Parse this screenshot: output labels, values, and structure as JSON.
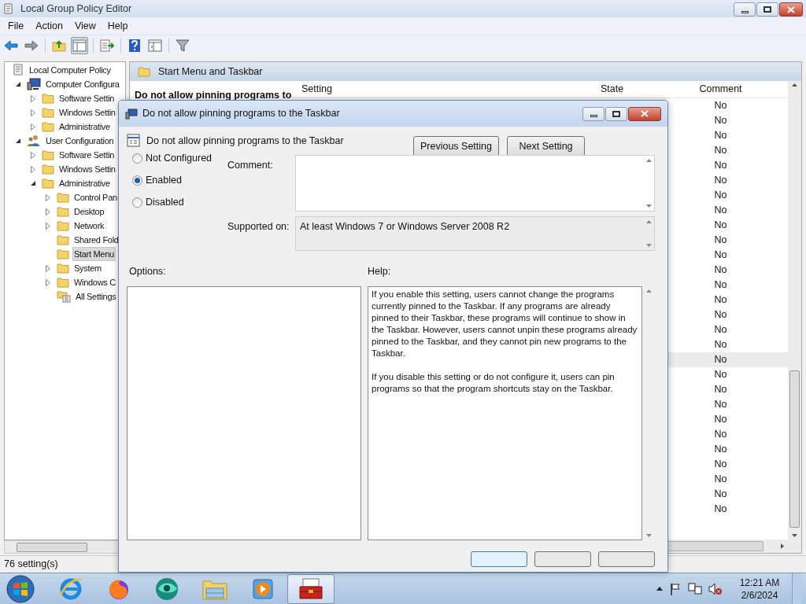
{
  "window": {
    "title": "Local Group Policy Editor"
  },
  "menu": [
    "File",
    "Action",
    "View",
    "Help"
  ],
  "toolbar": [
    {
      "kind": "back",
      "pressed": false
    },
    {
      "kind": "forward",
      "pressed": false
    },
    {
      "kind": "up",
      "pressed": false
    },
    {
      "kind": "tree",
      "pressed": true
    },
    {
      "kind": "export",
      "pressed": false
    },
    {
      "kind": "help",
      "pressed": false
    },
    {
      "kind": "properties",
      "pressed": false
    },
    {
      "kind": "filter",
      "pressed": false
    }
  ],
  "tree": [
    {
      "label": "Local Computer Policy",
      "kind": "policy",
      "selected": false,
      "children": [
        {
          "label": "Computer Configura",
          "kind": "computer",
          "selected": false,
          "expanded": true,
          "children": [
            {
              "label": "Software Settin",
              "kind": "folder",
              "selected": false,
              "expanded": false
            },
            {
              "label": "Windows Settin",
              "kind": "folder",
              "selected": false,
              "expanded": false
            },
            {
              "label": "Administrative",
              "kind": "folder",
              "selected": false,
              "expanded": false
            }
          ]
        },
        {
          "label": "User Configuration",
          "kind": "user",
          "selected": false,
          "expanded": true,
          "children": [
            {
              "label": "Software Settin",
              "kind": "folder",
              "selected": false,
              "expanded": false
            },
            {
              "label": "Windows Settin",
              "kind": "folder",
              "selected": false,
              "expanded": false
            },
            {
              "label": "Administrative",
              "kind": "folder",
              "selected": false,
              "expanded": true,
              "children": [
                {
                  "label": "Control Pan",
                  "kind": "folder",
                  "selected": false,
                  "expanded": false
                },
                {
                  "label": "Desktop",
                  "kind": "folder",
                  "selected": false,
                  "expanded": false
                },
                {
                  "label": "Network",
                  "kind": "folder",
                  "selected": false,
                  "expanded": false
                },
                {
                  "label": "Shared Fold",
                  "kind": "folder",
                  "selected": false
                },
                {
                  "label": "Start Menu",
                  "kind": "folder",
                  "selected": true
                },
                {
                  "label": "System",
                  "kind": "folder",
                  "selected": false,
                  "expanded": false
                },
                {
                  "label": "Windows C",
                  "kind": "folder",
                  "selected": false,
                  "expanded": false
                },
                {
                  "label": "All Settings",
                  "kind": "settings",
                  "selected": false
                }
              ]
            }
          ]
        }
      ]
    }
  ],
  "details": {
    "header": "Start Menu and Taskbar",
    "description_title": "Do not allow pinning programs to",
    "columns": [
      "Setting",
      "State",
      "Comment"
    ],
    "rows": [
      {
        "comment": "No",
        "selected": false
      },
      {
        "comment": "No",
        "selected": false
      },
      {
        "comment": "No",
        "selected": false
      },
      {
        "comment": "No",
        "selected": false
      },
      {
        "comment": "No",
        "selected": false
      },
      {
        "comment": "No",
        "selected": false
      },
      {
        "comment": "No",
        "selected": false
      },
      {
        "comment": "No",
        "selected": false
      },
      {
        "comment": "No",
        "selected": false
      },
      {
        "comment": "No",
        "selected": false
      },
      {
        "comment": "No",
        "selected": false
      },
      {
        "comment": "No",
        "selected": false
      },
      {
        "comment": "No",
        "selected": false
      },
      {
        "comment": "No",
        "selected": false
      },
      {
        "comment": "No",
        "selected": false
      },
      {
        "comment": "No",
        "selected": false
      },
      {
        "comment": "No",
        "selected": false
      },
      {
        "comment": "No",
        "selected": true
      },
      {
        "comment": "No",
        "selected": false
      },
      {
        "comment": "No",
        "selected": false
      },
      {
        "comment": "No",
        "selected": false
      },
      {
        "comment": "No",
        "selected": false
      },
      {
        "comment": "No",
        "selected": false
      },
      {
        "comment": "No",
        "selected": false
      },
      {
        "comment": "No",
        "selected": false
      },
      {
        "comment": "No",
        "selected": false
      },
      {
        "comment": "No",
        "selected": false
      },
      {
        "comment": "No",
        "selected": false
      }
    ]
  },
  "status_bar": "76 setting(s)",
  "dialog": {
    "title": "Do not allow pinning programs to the Taskbar",
    "setting_title": "Do not allow pinning programs to the Taskbar",
    "buttons": [
      "Previous Setting",
      "Next Setting"
    ],
    "options": [
      {
        "label": "Not Configured",
        "selected": false
      },
      {
        "label": "Enabled",
        "selected": true
      },
      {
        "label": "Disabled",
        "selected": false
      }
    ],
    "comment_label": "Comment:",
    "supported_label": "Supported on:",
    "supported_value": "At least Windows 7 or Windows Server 2008 R2",
    "options_label": "Options:",
    "help_label": "Help:",
    "help": [
      "If you enable this setting, users cannot change the programs currently pinned to the Taskbar. If any programs are already pinned to their Taskbar, these programs will continue to show in the Taskbar. However, users cannot unpin these programs already pinned to the Taskbar, and they cannot pin new programs to the Taskbar.",
      "If you disable this setting or do not configure it, users can pin programs so that the program shortcuts stay on the Taskbar."
    ]
  },
  "taskbar": {
    "apps": [
      {
        "kind": "browser-e",
        "selected": false
      },
      {
        "kind": "fox",
        "selected": false
      },
      {
        "kind": "orb",
        "selected": false
      },
      {
        "kind": "explorer",
        "selected": false
      },
      {
        "kind": "media",
        "selected": false
      },
      {
        "kind": "toolbox",
        "selected": true
      }
    ],
    "time": "12:21 AM",
    "date": "2/6/2024"
  }
}
